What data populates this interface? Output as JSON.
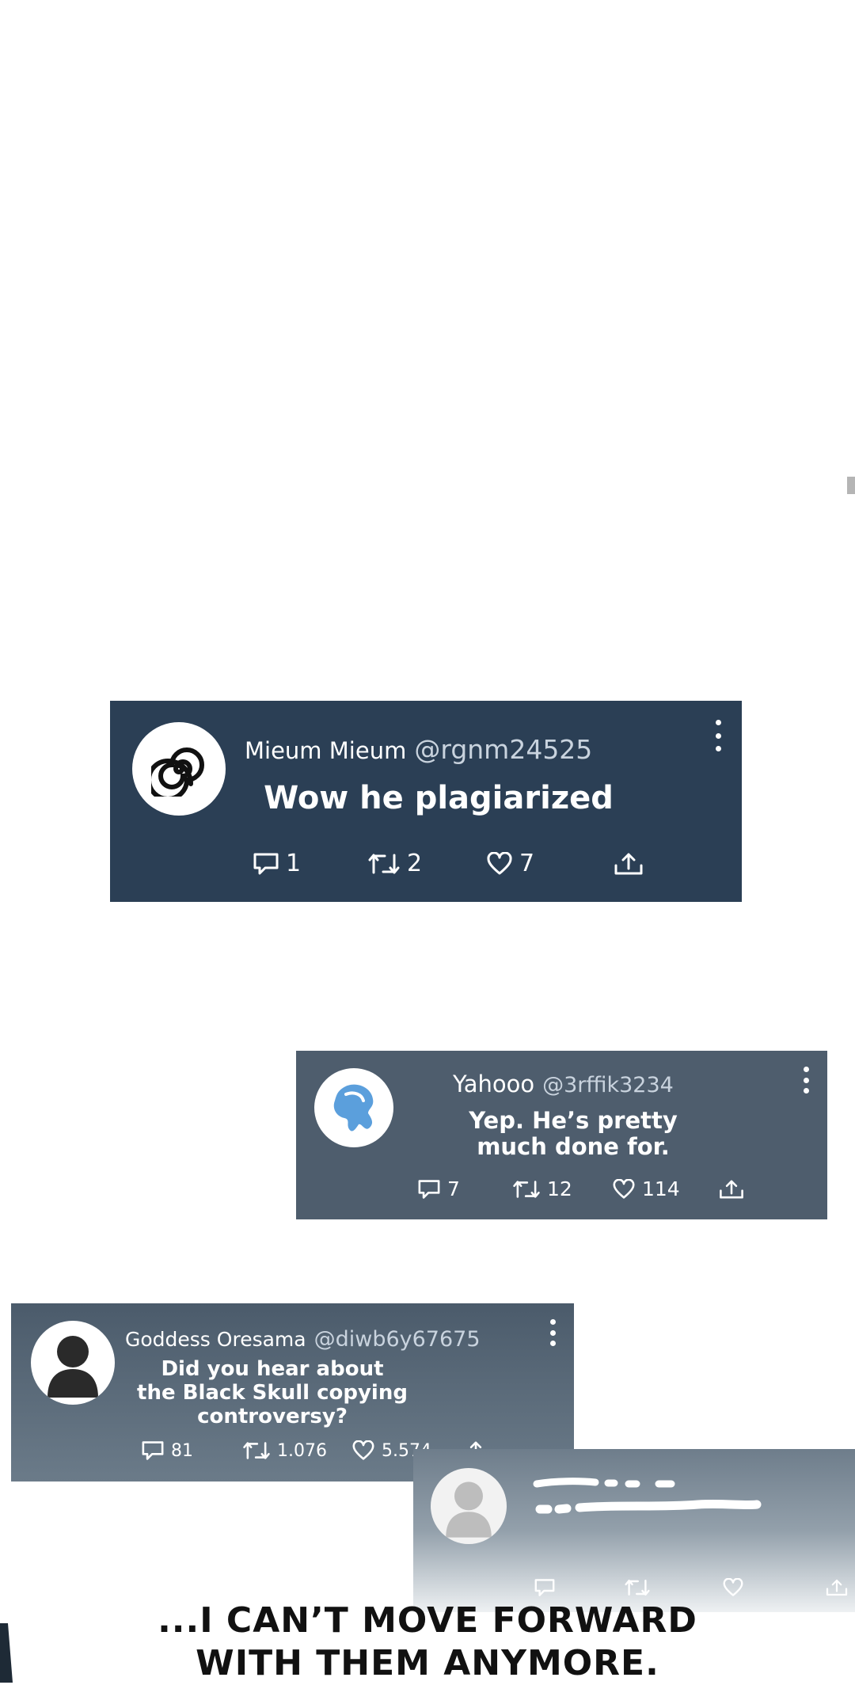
{
  "tweets": [
    {
      "display_name": "Mieum Mieum",
      "handle": "@rgnm24525",
      "message": "Wow he plagiarized",
      "avatar_icon": "spiral-icon",
      "replies": "1",
      "retweets": "2",
      "likes": "7"
    },
    {
      "display_name": "Yahooo",
      "handle": "@3rffik3234",
      "message": "Yep. He’s pretty\nmuch done for.",
      "avatar_icon": "blue-blob-icon",
      "replies": "7",
      "retweets": "12",
      "likes": "114"
    },
    {
      "display_name": "Goddess Oresama",
      "handle": "@diwb6y67675",
      "message": "Did you hear about\nthe Black Skull copying\ncontroversy?",
      "avatar_icon": "person-silhouette-icon",
      "replies": "81",
      "retweets": "1.076",
      "likes": "5.574"
    },
    {
      "avatar_icon": "person-silhouette-icon"
    }
  ],
  "caption": "...I CAN’T MOVE FORWARD\nWITH THEM ANYMORE.",
  "colors": {
    "card1": "#2b3f55",
    "card2": "#4e5d6d",
    "card3": "#4b5b6b",
    "card4": "#6e7d8b"
  }
}
